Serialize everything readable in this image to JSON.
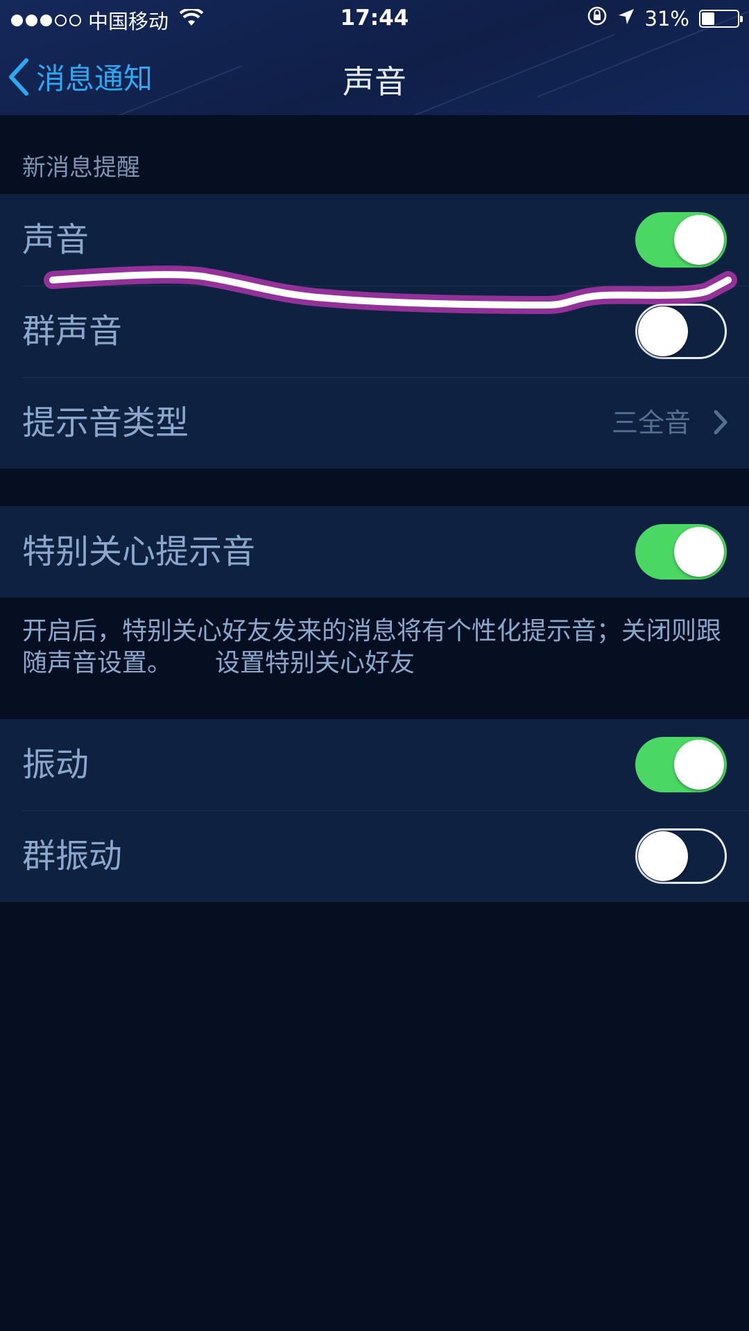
{
  "status_bar": {
    "carrier": "中国移动",
    "time": "17:44",
    "battery": "31%",
    "signal_bars_filled": 3,
    "signal_bars_total": 5,
    "battery_level": 0.31,
    "icons": [
      "wifi-icon",
      "orientation-lock-icon",
      "location-arrow-icon",
      "battery-icon"
    ]
  },
  "nav": {
    "back_label": "消息通知",
    "title": "声音"
  },
  "section1": {
    "header": "新消息提醒",
    "rows": [
      {
        "label": "声音",
        "toggle": true
      },
      {
        "label": "群声音",
        "toggle": false
      },
      {
        "label": "提示音类型",
        "value": "三全音"
      }
    ]
  },
  "section2": {
    "row": {
      "label": "特别关心提示音",
      "toggle": true
    },
    "description": "开启后，特别关心好友发来的消息将有个性化提示音；关闭则跟随声音设置。",
    "link": "设置特别关心好友"
  },
  "section3": {
    "rows": [
      {
        "label": "振动",
        "toggle": true
      },
      {
        "label": "群振动",
        "toggle": false
      }
    ]
  },
  "colors": {
    "background": "#050f21",
    "group_bg": "#0f2140",
    "toggle_on": "#4bd763",
    "back_link": "#2fa8f0",
    "annotation_stroke": "#ff3fe0"
  }
}
